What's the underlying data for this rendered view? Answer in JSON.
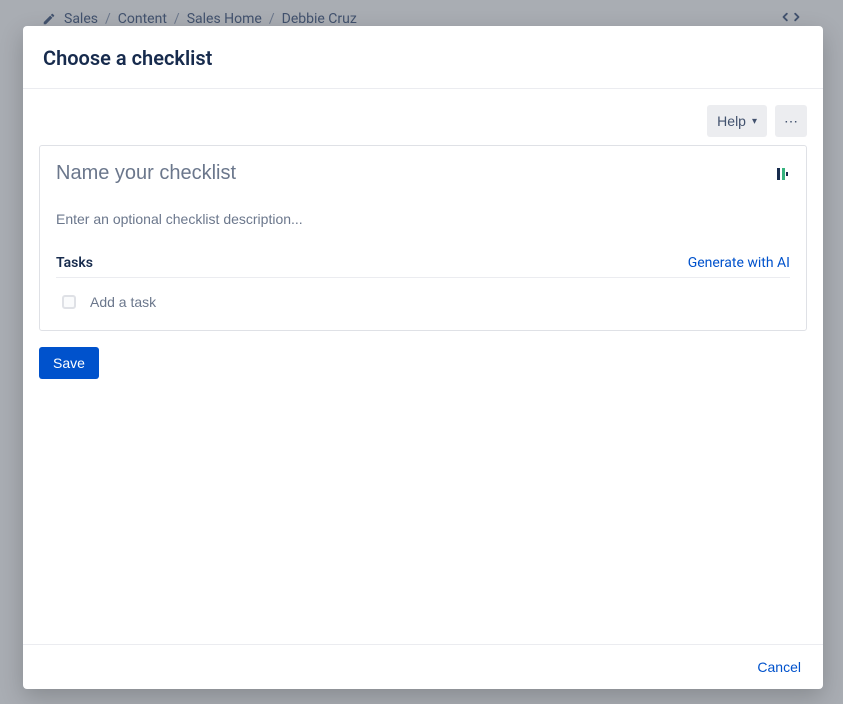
{
  "breadcrumbs": {
    "items": [
      "Sales",
      "Content",
      "Sales Home",
      "Debbie Cruz"
    ]
  },
  "modal": {
    "title": "Choose a checklist",
    "help_label": "Help"
  },
  "checklist": {
    "name_placeholder": "Name your checklist",
    "description_placeholder": "Enter an optional checklist description...",
    "tasks_label": "Tasks",
    "generate_ai_label": "Generate with AI",
    "add_task_placeholder": "Add a task"
  },
  "buttons": {
    "save": "Save",
    "cancel": "Cancel"
  }
}
